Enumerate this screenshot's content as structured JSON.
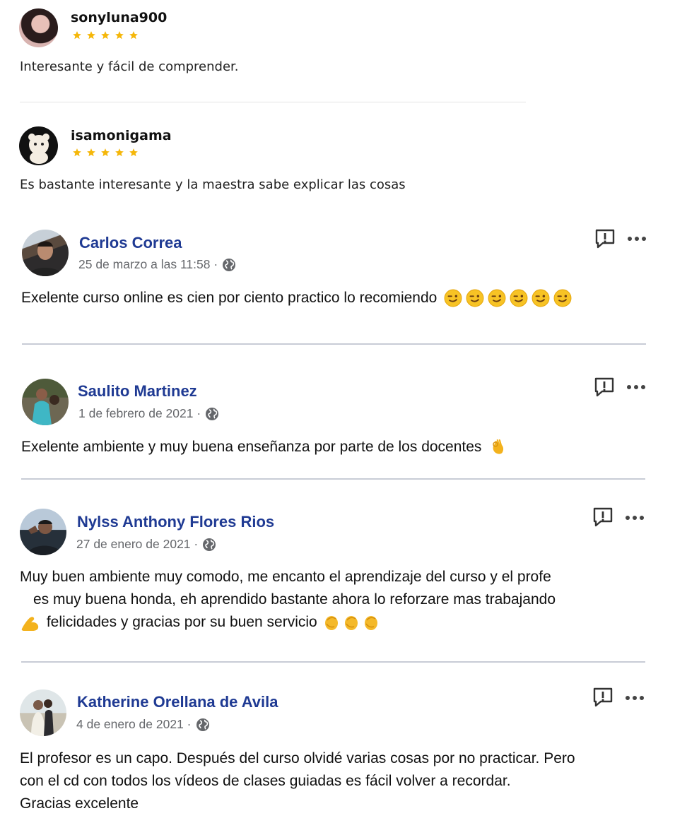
{
  "colors": {
    "star": "#f5b70a",
    "name_link": "#1f3a93",
    "date": "#65676b",
    "divider": "#c8ccd6"
  },
  "reviews": [
    {
      "user": "sonyluna900",
      "rating": 5,
      "text": "Interesante y fácil de comprender."
    },
    {
      "user": "isamonigama",
      "rating": 5,
      "text": "Es bastante interesante y la maestra sabe explicar las cosas"
    }
  ],
  "comments": [
    {
      "name": "Carlos Correa",
      "date": "25 de marzo a las 11:58 ·",
      "lines": [
        "Exelente curso online es cien por ciento practico lo recomiendo"
      ],
      "emoji": "winking-face x6"
    },
    {
      "name": "Saulito Martinez",
      "date": "1 de febrero de 2021 ·",
      "lines": [
        "Exelente ambiente y muy buena enseñanza por parte de los docentes"
      ],
      "emoji": "ok-hand"
    },
    {
      "name": "Nylss Anthony Flores Rios",
      "date": "27 de enero de 2021 ·",
      "lines": [
        "Muy buen ambiente muy comodo, me encanto el aprendizaje del curso y  el profe",
        "es muy buena honda, eh aprendido bastante ahora lo reforzare mas trabajando",
        "felicidades y gracias  por su buen servicio"
      ],
      "emoji": "flexed-biceps, clapping-hands x3"
    },
    {
      "name": "Katherine Orellana de Avila",
      "date": "4 de enero de 2021 ·",
      "lines": [
        "El profesor es un capo. Después del curso olvidé varias cosas por no practicar. Pero",
        "con el cd con todos los vídeos de clases guiadas es fácil volver a recordar.",
        "Gracias excelente"
      ]
    }
  ]
}
